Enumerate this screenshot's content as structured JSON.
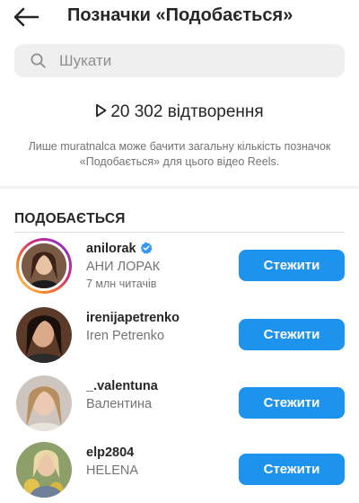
{
  "header": {
    "title": "Позначки «Подобається»"
  },
  "search": {
    "placeholder": "Шукати"
  },
  "stats": {
    "plays_text": "20 302 відтворення",
    "note": "Лише muratnalca може бачити загальну кількість позначок «Подобається» для цього відео Reels."
  },
  "likes_section": {
    "title": "ПОДОБАЄТЬСЯ",
    "users": [
      {
        "username": "anilorak",
        "verified": true,
        "full_name": "АНИ ЛОРАК",
        "followers": "7 млн читачів",
        "button": "Стежити",
        "story_ring": true
      },
      {
        "username": "irenijapetrenko",
        "verified": false,
        "full_name": "Iren Petrenko",
        "followers": "",
        "button": "Стежити",
        "story_ring": false
      },
      {
        "username": "_.valentuna",
        "verified": false,
        "full_name": "Валентина",
        "followers": "",
        "button": "Стежити",
        "story_ring": false
      },
      {
        "username": "elp2804",
        "verified": false,
        "full_name": "HELENA",
        "followers": "",
        "button": "Стежити",
        "story_ring": false
      }
    ]
  },
  "colors": {
    "follow_button": "#1d93ee",
    "verified_badge": "#3897f0",
    "search_background": "#efefef",
    "secondary_text": "#737373"
  }
}
